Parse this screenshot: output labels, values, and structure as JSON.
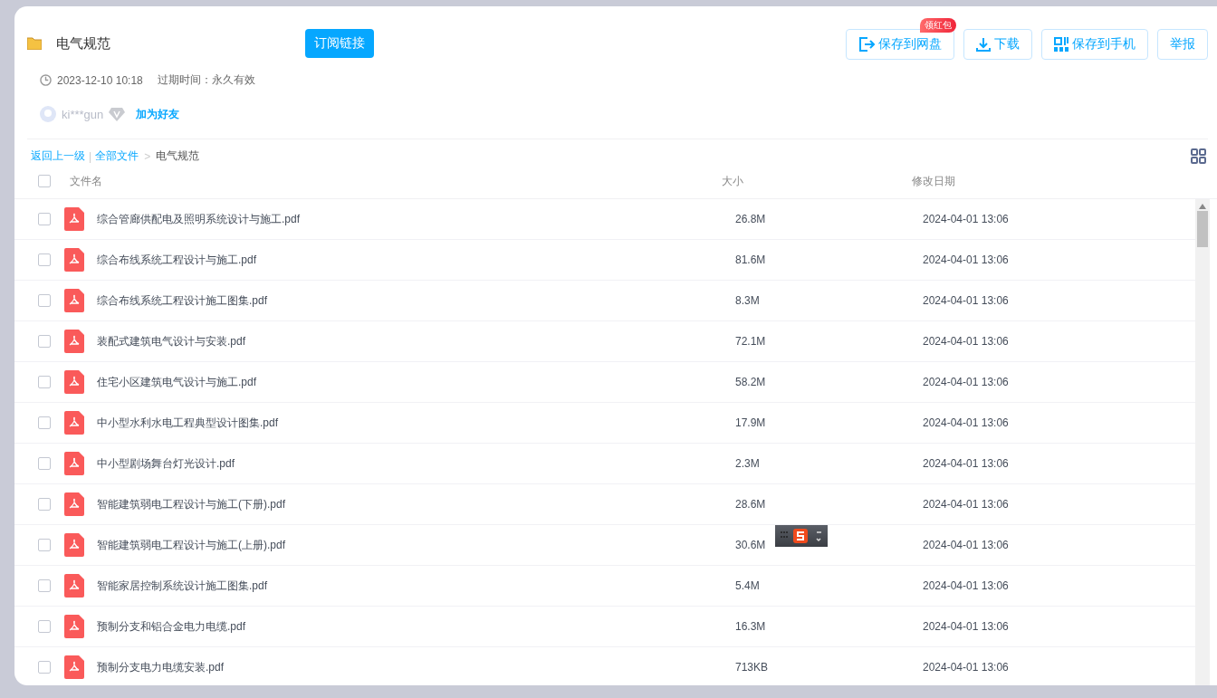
{
  "share": {
    "title": "电气规范",
    "subscribe_button": "订阅链接",
    "date": "2023-12-10 10:18",
    "expiry": "过期时间：永久有效",
    "user": "ki***gun",
    "add_friend": "加为好友"
  },
  "actions": [
    {
      "kind": "save",
      "label": "保存到网盘",
      "badge": "领红包"
    },
    {
      "kind": "download",
      "label": "下载"
    },
    {
      "kind": "phone",
      "label": "保存到手机"
    },
    {
      "kind": "report",
      "label": "举报"
    }
  ],
  "breadcrumb": {
    "back": "返回上一级",
    "divider": "|",
    "root": "全部文件",
    "separator": ">",
    "current": "电气规范"
  },
  "table": {
    "select_all_checked": false,
    "columns": [
      "文件名",
      "大小",
      "修改日期"
    ],
    "rows": [
      {
        "name": "综合管廊供配电及照明系统设计与施工.pdf",
        "size": "26.8M",
        "date": "2024-04-01 13:06",
        "checked": false
      },
      {
        "name": "综合布线系统工程设计与施工.pdf",
        "size": "81.6M",
        "date": "2024-04-01 13:06",
        "checked": false
      },
      {
        "name": "综合布线系统工程设计施工图集.pdf",
        "size": "8.3M",
        "date": "2024-04-01 13:06",
        "checked": false
      },
      {
        "name": "装配式建筑电气设计与安装.pdf",
        "size": "72.1M",
        "date": "2024-04-01 13:06",
        "checked": false
      },
      {
        "name": "住宅小区建筑电气设计与施工.pdf",
        "size": "58.2M",
        "date": "2024-04-01 13:06",
        "checked": false
      },
      {
        "name": "中小型水利水电工程典型设计图集.pdf",
        "size": "17.9M",
        "date": "2024-04-01 13:06",
        "checked": false
      },
      {
        "name": "中小型剧场舞台灯光设计.pdf",
        "size": "2.3M",
        "date": "2024-04-01 13:06",
        "checked": false
      },
      {
        "name": "智能建筑弱电工程设计与施工(下册).pdf",
        "size": "28.6M",
        "date": "2024-04-01 13:06",
        "checked": false
      },
      {
        "name": "智能建筑弱电工程设计与施工(上册).pdf",
        "size": "30.6M",
        "date": "2024-04-01 13:06",
        "checked": false,
        "ime_toolbar": true
      },
      {
        "name": "智能家居控制系统设计施工图集.pdf",
        "size": "5.4M",
        "date": "2024-04-01 13:06",
        "checked": false
      },
      {
        "name": "预制分支和铝合金电力电缆.pdf",
        "size": "16.3M",
        "date": "2024-04-01 13:06",
        "checked": false
      },
      {
        "name": "预制分支电力电缆安装.pdf",
        "size": "713KB",
        "date": "2024-04-01 13:06",
        "checked": false
      }
    ]
  }
}
